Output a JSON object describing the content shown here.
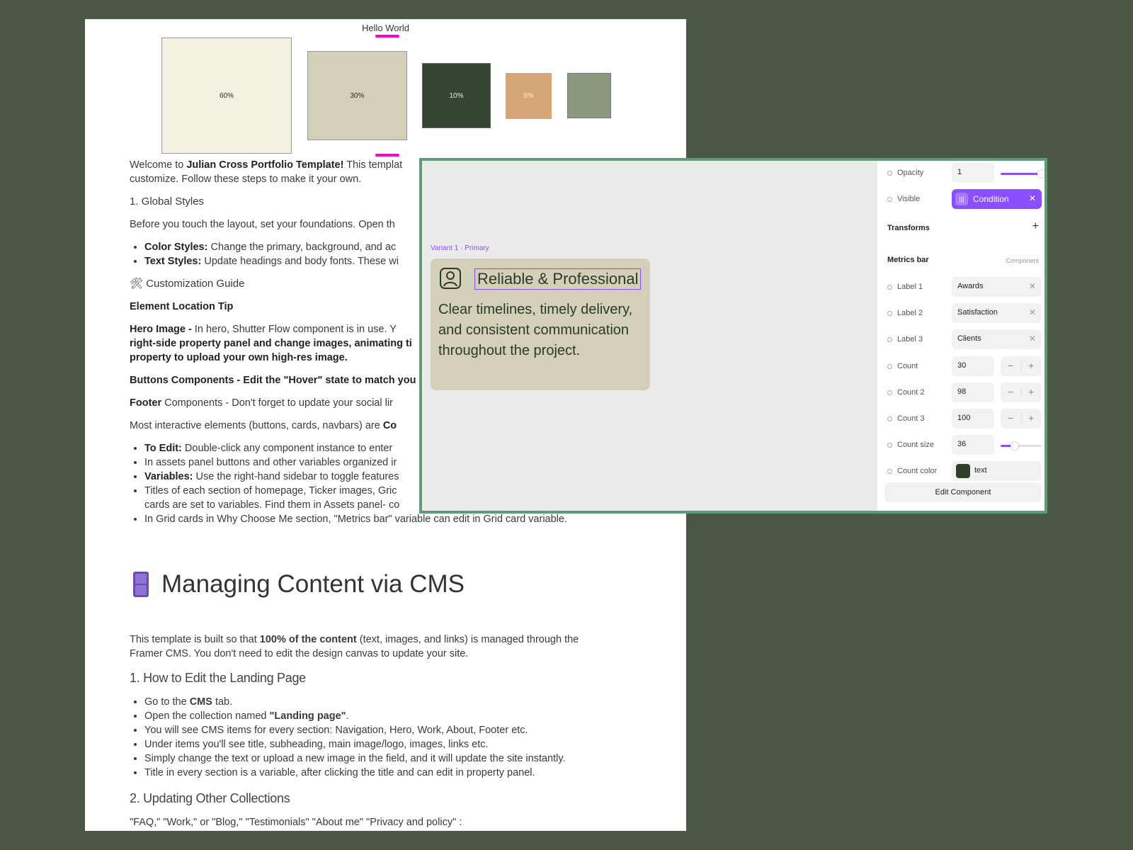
{
  "doc": {
    "hello": "Hello World",
    "swatches": [
      "60%",
      "30%",
      "10%",
      "5%",
      ""
    ],
    "intro_pre": "Welcome to ",
    "intro_bold": "Julian Cross Portfolio Template!",
    "intro_post": " This templat",
    "intro_line2": "customize. Follow these steps to make it your own.",
    "global_styles": "1. Global Styles",
    "before_text": "Before you touch the layout, set your foundations. Open th",
    "color_styles_b": "Color Styles:",
    "color_styles_t": " Change the primary, background, and ac",
    "text_styles_b": "Text Styles:",
    "text_styles_t": " Update headings and body fonts. These wi",
    "custom_guide": "🛠 Customization Guide",
    "element_tip": "Element Location Tip",
    "hero_b": "Hero Image - ",
    "hero_t": " In hero, Shutter Flow component is in use. Y",
    "hero_l2": "right-side property panel and change images, animating ti",
    "hero_l3": "property to upload your own high-res image.",
    "buttons_b": "Buttons",
    "buttons_t": " Components - Edit the \"Hover\" state to match you",
    "footer_b": "Footer",
    "footer_t": " Components - Don't forget to update your social lir",
    "most_pre": "Most interactive elements (buttons, cards, navbars) are ",
    "most_b": "Co",
    "to_edit_b": "To Edit:",
    "to_edit_t": " Double-click any component instance to enter",
    "assets_t": "In assets panel buttons and other variables organized ir",
    "variables_b": "Variables:",
    "variables_t": " Use the right-hand sidebar to toggle features",
    "titles_t": "Titles of each section of homepage, Ticker images, Gric",
    "titles_l2": "cards are set to variables. Find them in Assets panel- co",
    "grid_t": "In Grid cards in Why Choose Me section, \"Metrics bar\" variable can edit in Grid card variable.",
    "cms_title": "Managing Content via CMS",
    "cms_pre": "This template is built so that ",
    "cms_b": "100% of the content",
    "cms_post": " (text, images, and links) is managed through the",
    "cms_l2": "Framer CMS. You don't need to edit the design canvas to update your site.",
    "how_edit": "1. How to Edit the Landing Page",
    "b1_pre": "Go to the ",
    "b1_b": "CMS",
    "b1_post": " tab.",
    "b2_pre": "Open the collection named ",
    "b2_b": "\"Landing page\"",
    "b2_post": ".",
    "b3": "You will see CMS items for every section: Navigation, Hero, Work, About, Footer etc.",
    "b4": "Under items you'll see title, subheading, main image/logo, images, links etc.",
    "b5": "Simply change the text or upload a new image in the field, and it will update the site instantly.",
    "b6": "Title in every section is a variable, after clicking the title and can edit in property panel.",
    "updating": "2. Updating Other Collections",
    "collections": "\"FAQ,\" \"Work,\" or \"Blog,\"  \"Testimonials\" \"About me\" \"Privacy and  policy\" :"
  },
  "canvas": {
    "variant_label": "Variant 1 · Primary",
    "card_title": "Reliable & Professional",
    "card_text": "Clear timelines, timely delivery, and consistent communication throughout the project."
  },
  "props": {
    "opacity_label": "Opacity",
    "opacity_value": "1",
    "opacity_level": 1.0,
    "visible_label": "Visible",
    "visible_value": "Condition",
    "transforms": "Transforms",
    "metrics_bar": "Metrics bar",
    "component_tag": "Component",
    "label1": "Label 1",
    "label1_value": "Awards",
    "label2": "Label 2",
    "label2_value": "Satisfaction",
    "label3": "Label 3",
    "label3_value": "Clients",
    "count": "Count",
    "count_value": "30",
    "count2": "Count 2",
    "count2_value": "98",
    "count3": "Count 3",
    "count3_value": "100",
    "count_size": "Count size",
    "count_size_value": "36",
    "count_size_level": 0.35,
    "count_color": "Count color",
    "count_color_value": "text",
    "count_color_hex": "#2f3d2a",
    "edit_button": "Edit Component"
  },
  "colors": {
    "background": "#4c5846",
    "accent_purple": "#8a4fff",
    "highlight_pink": "#ff00cc",
    "panel_border": "#5f9b76",
    "swatch_60": "#f3f1e1",
    "swatch_30": "#d4cfb8",
    "swatch_10": "#344631",
    "swatch_5": "#d6a678",
    "swatch_extra": "#8b9a7f"
  },
  "icons": [
    "user-badge-icon",
    "condition-icon",
    "close-icon",
    "plus-icon",
    "minus-icon",
    "file-cabinet-icon",
    "hammer-wrench-icon"
  ]
}
